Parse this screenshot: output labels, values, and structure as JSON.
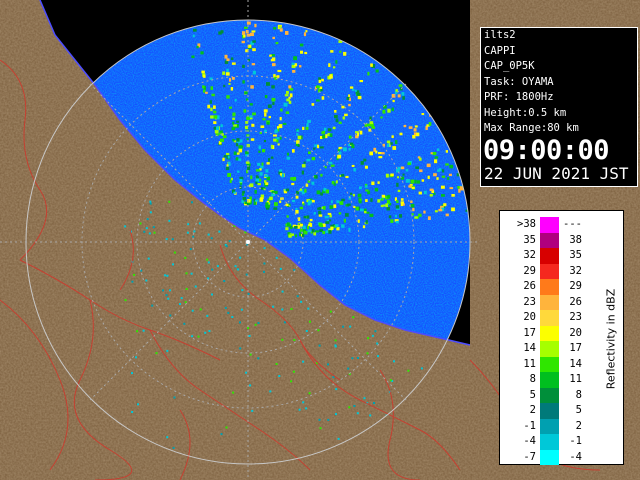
{
  "map": {
    "radar_name": "ilts2",
    "product": "CAPPI",
    "product_code": "CAP_0P5K",
    "task": "Task: OYAMA",
    "prf": "PRF: 1800Hz",
    "height": "Height:0.5 km",
    "max_range": "Max Range:80 km",
    "time": "09:00:00",
    "date": "22 JUN 2021 JST"
  },
  "legend": {
    "title": "Reflectivity in dBZ",
    "rows": [
      {
        "lo": ">38",
        "hi": "---",
        "color": "#ff00ff"
      },
      {
        "lo": "35",
        "hi": "38",
        "color": "#b0007e"
      },
      {
        "lo": "32",
        "hi": "35",
        "color": "#d70000"
      },
      {
        "lo": "29",
        "hi": "32",
        "color": "#f5281f"
      },
      {
        "lo": "26",
        "hi": "29",
        "color": "#ff7a1a"
      },
      {
        "lo": "23",
        "hi": "26",
        "color": "#ffb43c"
      },
      {
        "lo": "20",
        "hi": "23",
        "color": "#ffd93b"
      },
      {
        "lo": "17",
        "hi": "20",
        "color": "#fcff00"
      },
      {
        "lo": "14",
        "hi": "17",
        "color": "#a6ff00"
      },
      {
        "lo": "11",
        "hi": "14",
        "color": "#2fe600"
      },
      {
        "lo": "8",
        "hi": "11",
        "color": "#00bf1f"
      },
      {
        "lo": "5",
        "hi": "8",
        "color": "#008f3a"
      },
      {
        "lo": "2",
        "hi": "5",
        "color": "#007a7a"
      },
      {
        "lo": "-1",
        "hi": "2",
        "color": "#00a0b0"
      },
      {
        "lo": "-4",
        "hi": "-1",
        "color": "#00c8d8"
      },
      {
        "lo": "-7",
        "hi": "-4",
        "color": "#00ffff"
      }
    ]
  },
  "colors": {
    "sea": "#0b1f7a",
    "land": "#8a6b45",
    "echo_low": "#1650ff",
    "echo_mid": "#00c8d8",
    "grid": "#a9a9a9",
    "coast": "#4c4cff",
    "river": "#cc3b2e"
  }
}
